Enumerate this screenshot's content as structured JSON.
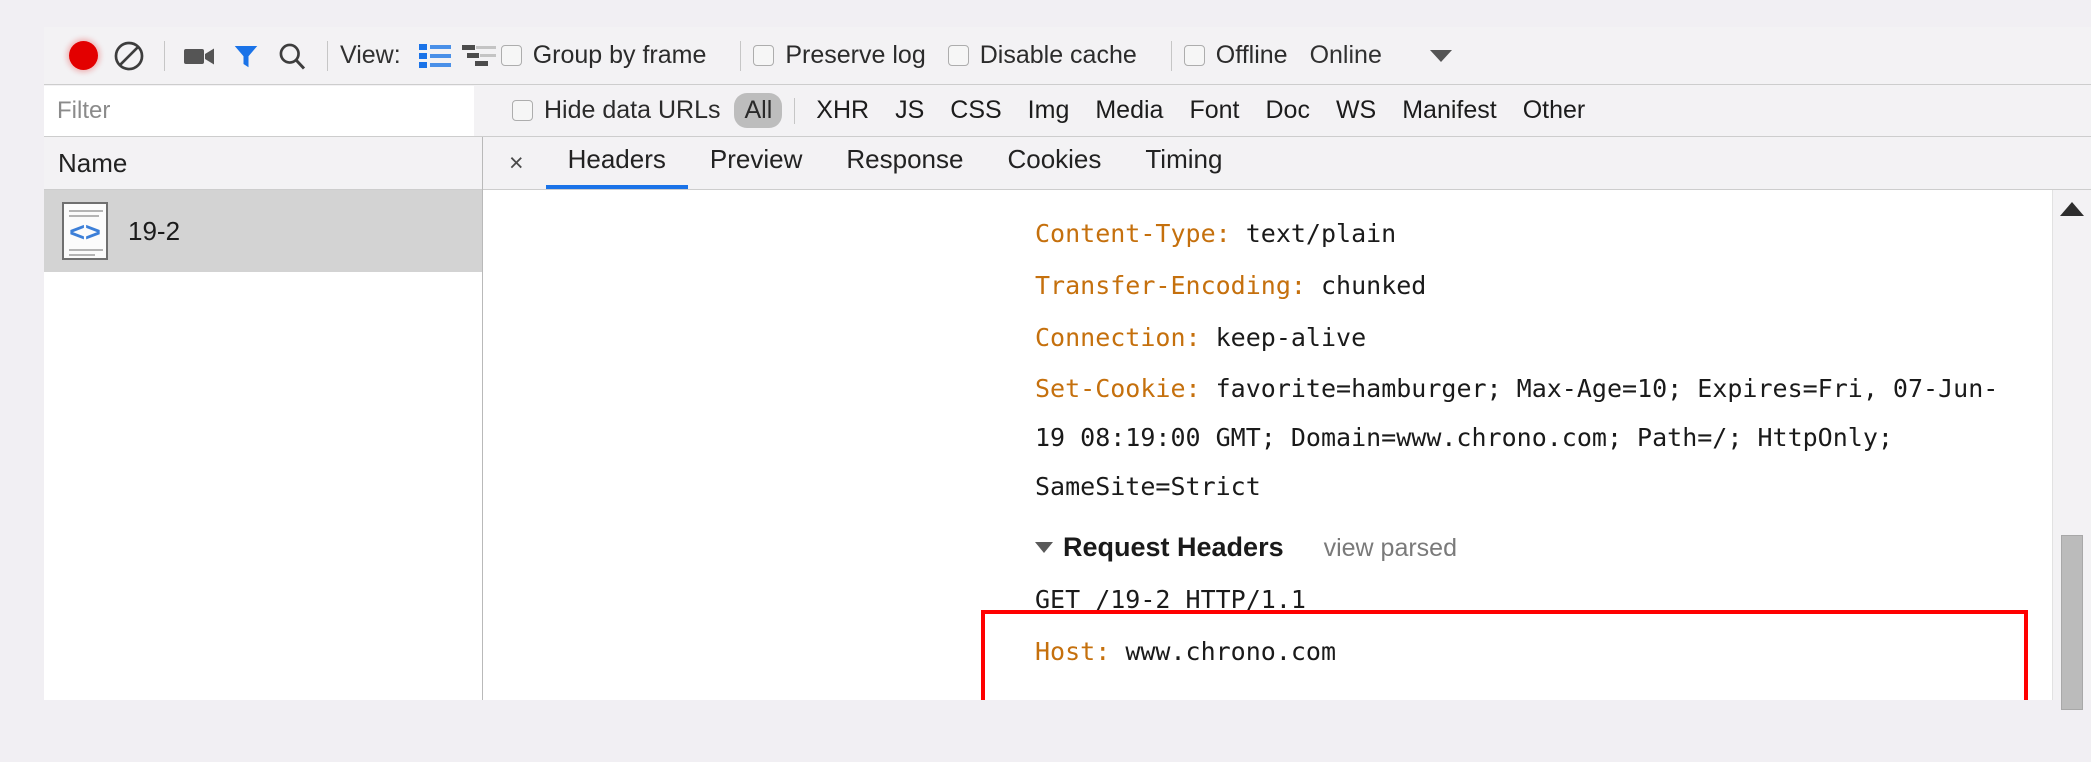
{
  "toolbar": {
    "record_icon": "record-dot-icon",
    "clear_icon": "clear-no-entry-icon",
    "camera_icon": "camera-filmstrip-icon",
    "filter_icon": "funnel-filter-icon",
    "search_icon": "magnifier-search-icon",
    "view_label": "View:",
    "view_list_icon": "list-view-icon",
    "view_waterfall_icon": "waterfall-view-icon",
    "group_by_frame": "Group by frame",
    "preserve_log": "Preserve log",
    "disable_cache": "Disable cache",
    "offline": "Offline",
    "online": "Online",
    "throttle_caret_icon": "chevron-down-icon"
  },
  "filterbar": {
    "filter_placeholder": "Filter",
    "filter_value": "",
    "hide_data_urls": "Hide data URLs",
    "types": [
      "All",
      "XHR",
      "JS",
      "CSS",
      "Img",
      "Media",
      "Font",
      "Doc",
      "WS",
      "Manifest",
      "Other"
    ],
    "active_type": "All"
  },
  "left_pane": {
    "column_header": "Name",
    "requests": [
      {
        "name": "19-2",
        "icon": "document-code-icon",
        "selected": true
      }
    ]
  },
  "detail": {
    "close_label": "×",
    "tabs": [
      {
        "label": "Headers",
        "active": true
      },
      {
        "label": "Preview",
        "active": false
      },
      {
        "label": "Response",
        "active": false
      },
      {
        "label": "Cookies",
        "active": false
      },
      {
        "label": "Timing",
        "active": false
      }
    ],
    "response_header_lines": [
      {
        "name": "Content-Type:",
        "value": " text/plain"
      },
      {
        "name": "Transfer-Encoding:",
        "value": " chunked"
      },
      {
        "name": "Connection:",
        "value": " keep-alive"
      },
      {
        "name": "Set-Cookie:",
        "value": " favorite=hamburger; Max-Age=10; Expires=Fri, 07-Jun-19 08:19:00 GMT; Domain=www.chrono.com; Path=/; HttpOnly; SameSite=Strict"
      }
    ],
    "request_section": {
      "title": "Request Headers",
      "view_parsed": "view parsed",
      "caret_icon": "caret-down-icon",
      "lines": [
        {
          "name": "",
          "value": "GET /19-2 HTTP/1.1"
        },
        {
          "name": "Host:",
          "value": " www.chrono.com"
        }
      ]
    },
    "highlight_color": "#ff0000",
    "scroll_up_icon": "scroll-up-arrow-icon"
  }
}
